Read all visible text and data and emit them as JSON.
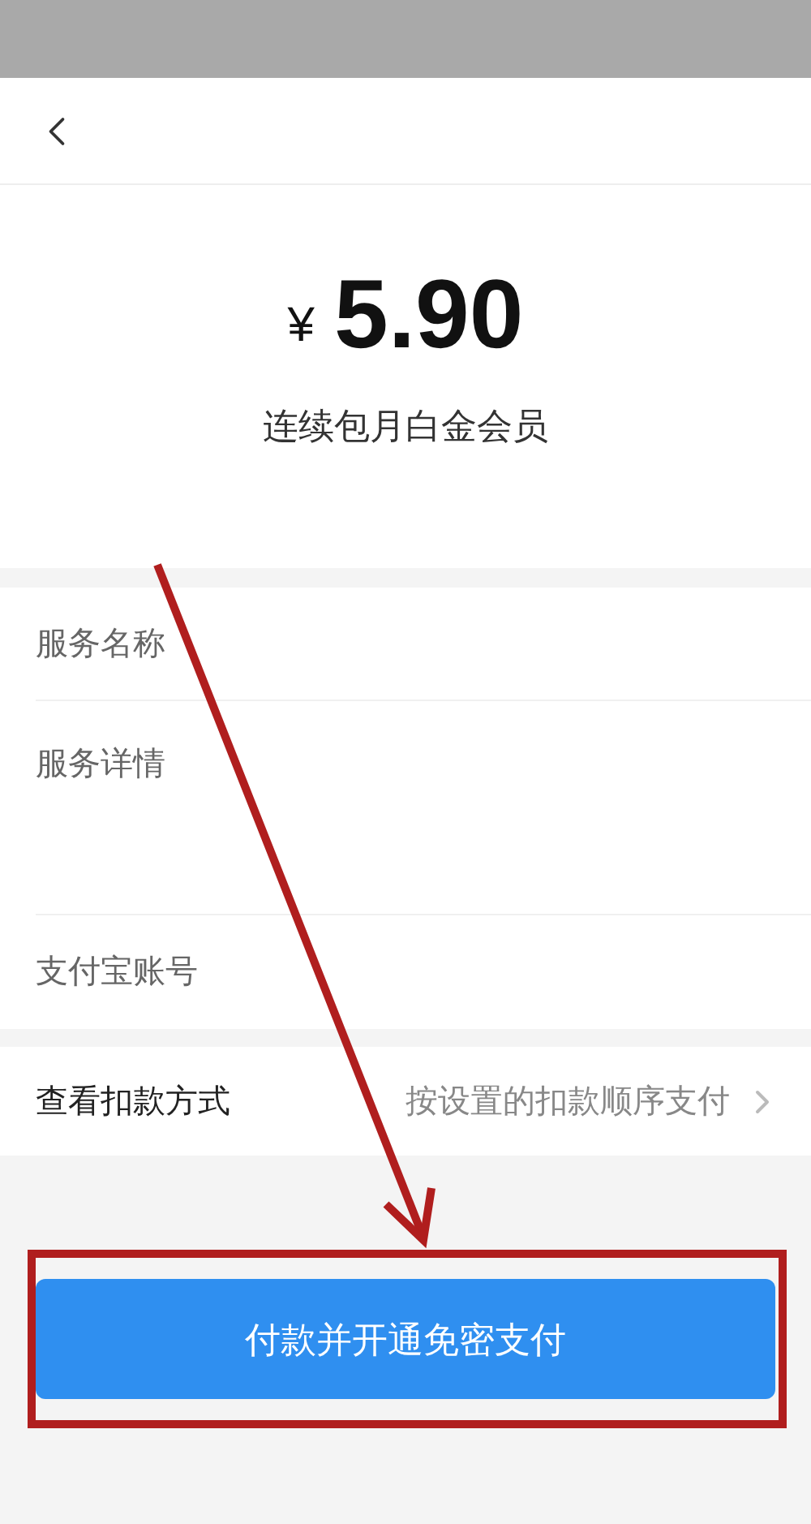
{
  "amount": {
    "currency": "¥",
    "value": "5.90",
    "product": "连续包月白金会员"
  },
  "details": [
    {
      "label": "服务名称",
      "kind": "short"
    },
    {
      "label": "服务详情",
      "kind": "tall"
    },
    {
      "label": "支付宝账号",
      "kind": "short"
    }
  ],
  "payment_method": {
    "label": "查看扣款方式",
    "value": "按设置的扣款顺序支付"
  },
  "pay_button": "付款并开通免密支付"
}
